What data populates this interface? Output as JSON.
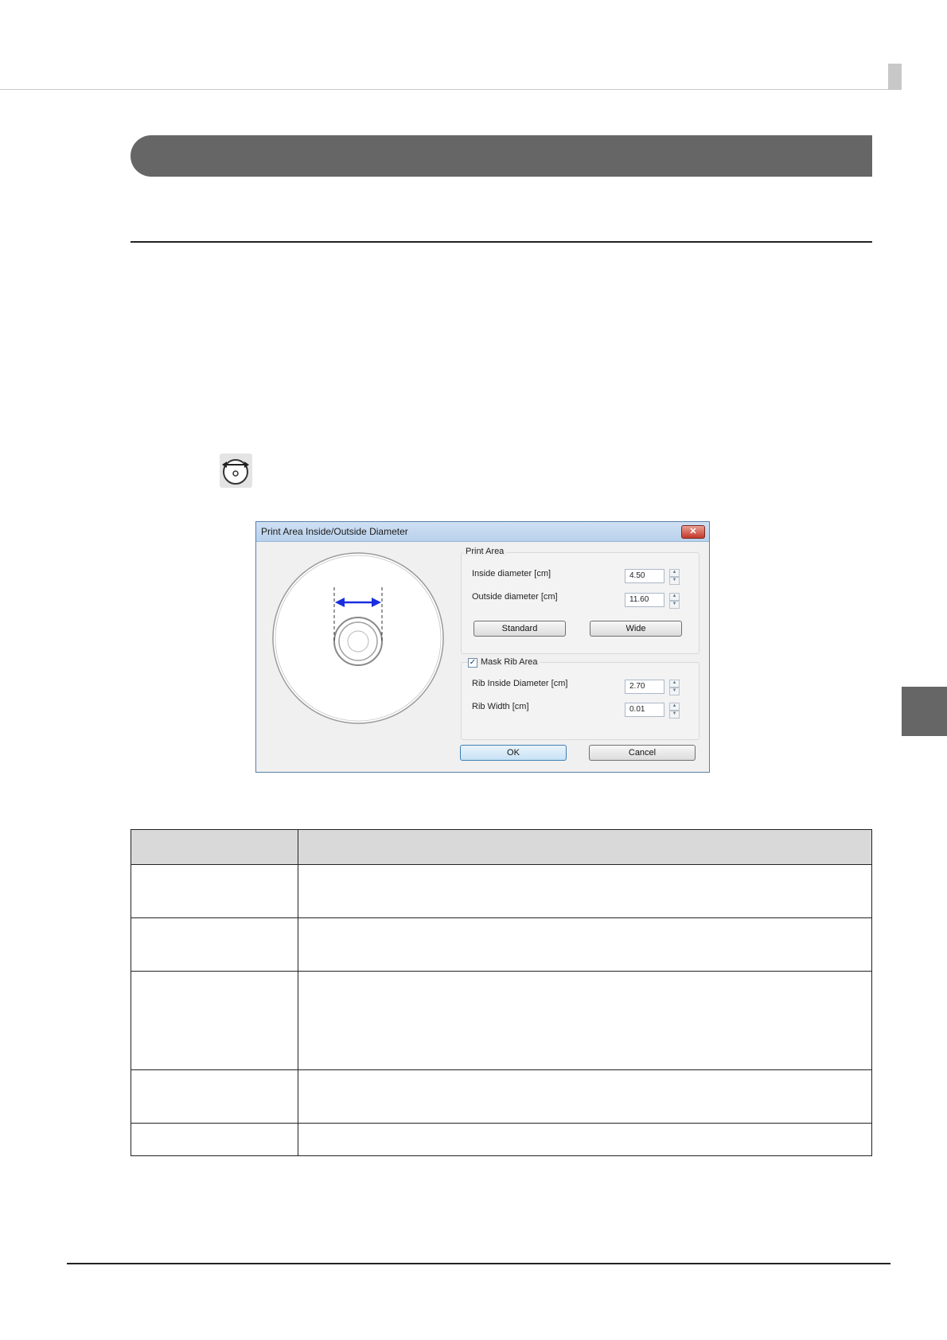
{
  "dialog": {
    "title": "Print Area Inside/Outside Diameter",
    "close_label": "✕",
    "print_area": {
      "group_title": "Print Area",
      "inside_label": "Inside diameter [cm]",
      "inside_value": "4.50",
      "outside_label": "Outside diameter [cm]",
      "outside_value": "11.60",
      "standard_label": "Standard",
      "wide_label": "Wide"
    },
    "mask_rib": {
      "checkbox_label": "Mask Rib Area",
      "checked_mark": "✓",
      "rib_inside_label": "Rib Inside Diameter [cm]",
      "rib_inside_value": "2.70",
      "rib_width_label": "Rib Width [cm]",
      "rib_width_value": "0.01"
    },
    "ok_label": "OK",
    "cancel_label": "Cancel",
    "spin_up": "▲",
    "spin_down": "▼"
  },
  "icons": {
    "toolbar_icon": "cd-diameter-icon",
    "accent_blue": "#1a2ee0"
  },
  "colors": {
    "banner": "#666666",
    "table_header": "#d9d9d9"
  }
}
